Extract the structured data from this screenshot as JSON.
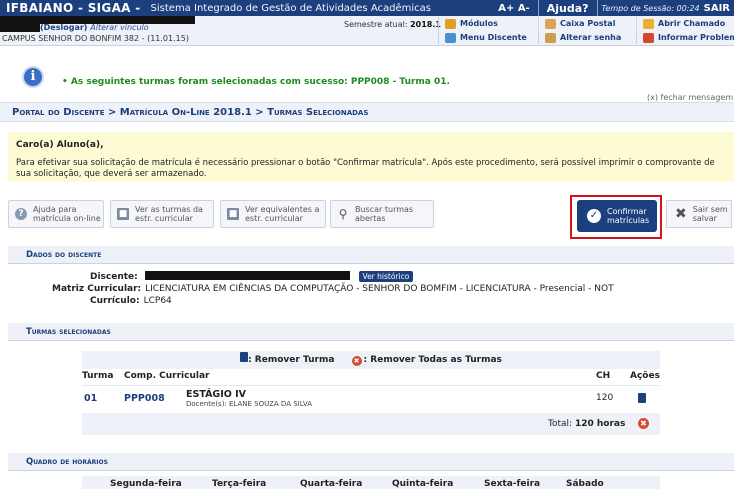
{
  "topbar": {
    "brand": "IFBAIANO - SIGAA -",
    "system_name": "Sistema Integrado de Gestão de Atividades Acadêmicas",
    "font_controls": "A+ A-",
    "help": "Ajuda?",
    "session_label": "Tempo de Sessão: 00:24",
    "exit": "SAIR"
  },
  "infobar": {
    "logout": "(Deslogar)",
    "change_link": "Alterar vínculo",
    "campus": "CAMPUS SENHOR DO BONFIM 382 - (11.01.15)",
    "semester_label": "Semestre atual:",
    "semester_value": "2018.1",
    "links": [
      {
        "label": "Módulos",
        "icon": "modules-icon",
        "color": "#e0a020"
      },
      {
        "label": "Caixa Postal",
        "icon": "mailbox-icon",
        "color": "#d9a35a"
      },
      {
        "label": "Abrir Chamado",
        "icon": "ticket-icon",
        "color": "#e8b030"
      },
      {
        "label": "Menu Discente",
        "icon": "menu-icon",
        "color": "#4a90d0"
      },
      {
        "label": "Alterar senha",
        "icon": "key-icon",
        "color": "#c9a14a"
      },
      {
        "label": "Informar Problema",
        "icon": "warning-icon",
        "color": "#d24a2a"
      }
    ]
  },
  "message": {
    "text": "As seguintes turmas foram selecionadas com sucesso: PPP008 - Turma 01.",
    "close": "(x) fechar mensagem"
  },
  "breadcrumb": "Portal do Discente > Matrícula On-Line 2018.1 > Turmas Selecionadas",
  "note": {
    "greeting": "Caro(a) Aluno(a),",
    "body": "Para efetivar sua solicitação de matrícula é necessário pressionar o botão \"Confirmar matrícula\". Após este procedimento, será possível imprimir o comprovante de sua solicitação, que deverá ser armazenado."
  },
  "actions": {
    "help": [
      "Ajuda para",
      "matrícula on-line"
    ],
    "view_curricular": [
      "Ver as turmas da",
      "estr. curricular"
    ],
    "view_equivalents": [
      "Ver equivalentes a",
      "estr. curricular"
    ],
    "search_open": [
      "Buscar turmas",
      "abertas"
    ],
    "confirm": [
      "Confirmar",
      "matrículas"
    ],
    "exit": [
      "Sair sem",
      "salvar"
    ]
  },
  "student": {
    "section_title": "Dados do discente",
    "discente_label": "Discente:",
    "history_button": "Ver histórico",
    "matriz_label": "Matriz Curricular:",
    "matriz_value": "LICENCIATURA EM CIÊNCIAS DA COMPUTAÇÃO - SENHOR DO BOMFIM - LICENCIATURA - Presencial - NOT",
    "curriculo_label": "Currículo:",
    "curriculo_value": "LCP64"
  },
  "turmas": {
    "section_title": "Turmas selecionadas",
    "legend_remove": ": Remover Turma",
    "legend_remove_all": ": Remover Todas as Turmas",
    "headers": {
      "turma": "Turma",
      "comp": "Comp. Curricular",
      "ch": "CH",
      "acoes": "Ações"
    },
    "rows": [
      {
        "turma": "01",
        "code": "PPP008",
        "name": "ESTÁGIO IV",
        "docente": "Docente(s): ELANE SOUZA DA SILVA",
        "ch": "120"
      }
    ],
    "total_label": "Total:",
    "total_value": "120 horas"
  },
  "schedule": {
    "section_title": "Quadro de horários",
    "days": [
      "Segunda-feira",
      "Terça-feira",
      "Quarta-feira",
      "Quinta-feira",
      "Sexta-feira",
      "Sábado"
    ]
  }
}
